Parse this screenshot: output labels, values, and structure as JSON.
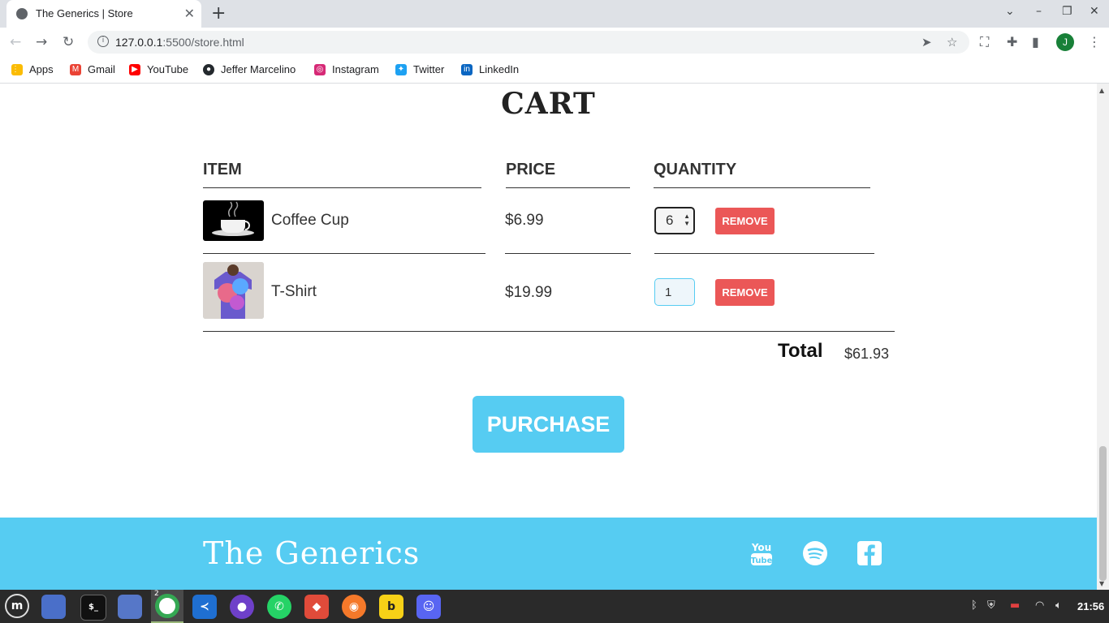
{
  "browser": {
    "tab_title": "The Generics | Store",
    "url_host": "127.0.0.1",
    "url_path": ":5500/store.html",
    "profile_initial": "J",
    "bookmarks": [
      {
        "label": "Apps",
        "icon": "apps-grid-icon"
      },
      {
        "label": "Gmail",
        "icon": "gmail-icon"
      },
      {
        "label": "YouTube",
        "icon": "youtube-icon"
      },
      {
        "label": "Jeffer Marcelino",
        "icon": "github-icon"
      },
      {
        "label": "Instagram",
        "icon": "instagram-icon"
      },
      {
        "label": "Twitter",
        "icon": "twitter-icon"
      },
      {
        "label": "LinkedIn",
        "icon": "linkedin-icon"
      }
    ]
  },
  "page": {
    "cart_title": "CART",
    "columns": {
      "item": "ITEM",
      "price": "PRICE",
      "quantity": "QUANTITY"
    },
    "items": [
      {
        "name": "Coffee Cup",
        "price": "$6.99",
        "quantity": "6",
        "remove_label": "REMOVE"
      },
      {
        "name": "T-Shirt",
        "price": "$19.99",
        "quantity": "1",
        "remove_label": "REMOVE"
      }
    ],
    "total_label": "Total",
    "total_value": "$61.93",
    "purchase_label": "PURCHASE",
    "footer_brand": "The Generics",
    "social": [
      "youtube-icon",
      "spotify-icon",
      "facebook-icon"
    ],
    "accent_color": "#56ccf2",
    "remove_color": "#eb5757"
  },
  "taskbar": {
    "clock": "21:56",
    "chrome_badge": "2"
  }
}
